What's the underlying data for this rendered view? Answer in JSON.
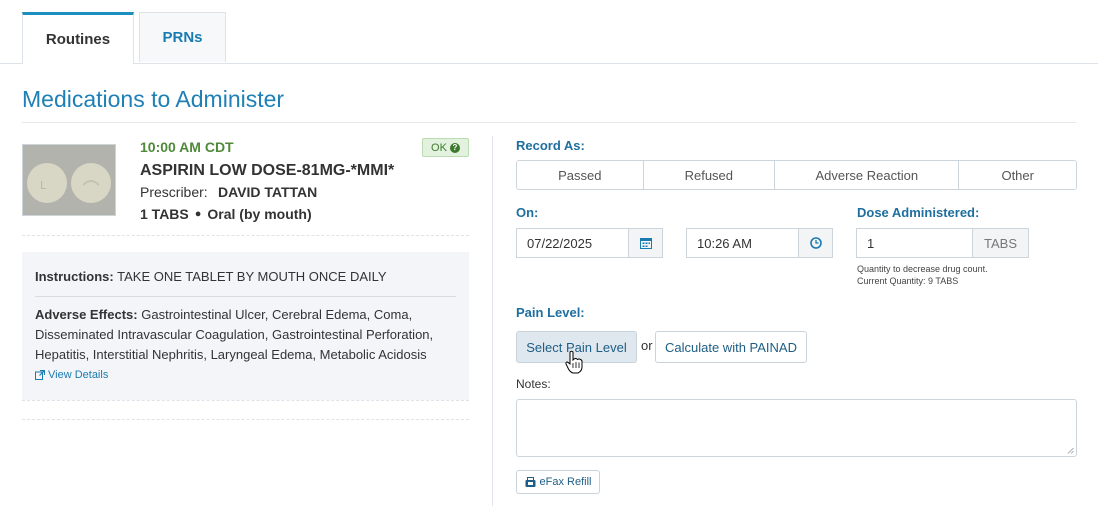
{
  "tabs": [
    {
      "label": "Routines",
      "active": true
    },
    {
      "label": "PRNs",
      "active": false
    }
  ],
  "page_title": "Medications to Administer",
  "medication": {
    "time": "10:00 AM CDT",
    "status_badge": "OK",
    "name": "ASPIRIN LOW DOSE-81MG-*MMI*",
    "prescriber_label": "Prescriber:",
    "prescriber_name": "DAVID TATTAN",
    "dose": "1 TABS",
    "route": "Oral (by mouth)",
    "instructions_label": "Instructions:",
    "instructions": "TAKE ONE TABLET BY MOUTH ONCE DAILY",
    "adverse_label": "Adverse Effects:",
    "adverse_effects": "Gastrointestinal Ulcer, Cerebral Edema, Coma, Disseminated Intravascular Coagulation, Gastrointestinal Perforation, Hepatitis, Interstitial Nephritis, Laryngeal Edema, Metabolic Acidosis",
    "view_details": "View Details"
  },
  "record": {
    "record_as_label": "Record As:",
    "options": [
      "Passed",
      "Refused",
      "Adverse Reaction",
      "Other"
    ],
    "on_label": "On:",
    "date": "07/22/2025",
    "time": "10:26 AM",
    "dose_label": "Dose Administered:",
    "dose_value": "1",
    "dose_unit": "TABS",
    "hint_line1": "Quantity to decrease drug count.",
    "hint_line2": "Current Quantity: 9 TABS",
    "pain_label": "Pain Level:",
    "select_pain": "Select Pain Level",
    "or_text": "or",
    "painad": "Calculate with PAINAD",
    "notes_label": "Notes:",
    "efax": "eFax Refill"
  },
  "colors": {
    "accent": "#1e80b6",
    "ok": "#4f8a3a"
  },
  "icons": [
    "calendar-icon",
    "clock-icon",
    "question-circle-icon",
    "external-link-icon",
    "fax-icon",
    "hand-cursor-icon"
  ]
}
